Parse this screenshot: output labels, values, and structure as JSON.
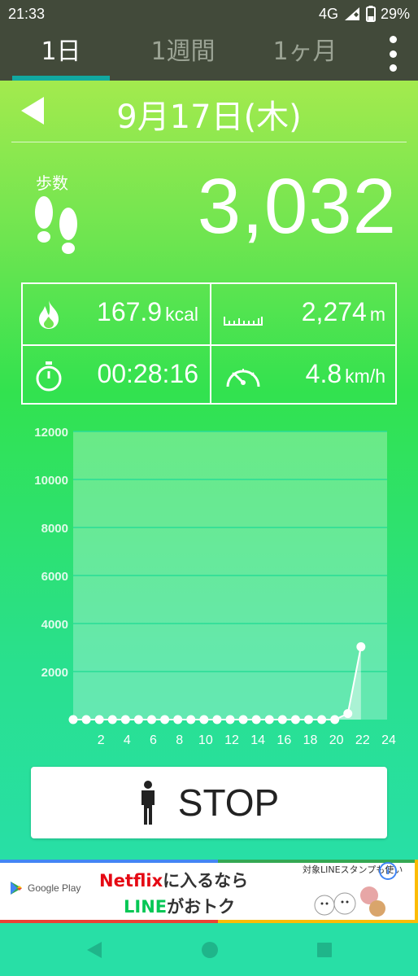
{
  "status_bar": {
    "time": "21:33",
    "network": "4G",
    "battery": "29%"
  },
  "tabs": [
    {
      "label": "1日",
      "active": true
    },
    {
      "label": "1週間",
      "active": false
    },
    {
      "label": "1ヶ月",
      "active": false
    }
  ],
  "date": "9月17日(木)",
  "steps": {
    "label": "歩数",
    "value": "3,032"
  },
  "stats": {
    "calories": {
      "value": "167.9",
      "unit": "kcal"
    },
    "distance": {
      "value": "2,274",
      "unit": "m"
    },
    "duration": {
      "value": "00:28:16"
    },
    "speed": {
      "value": "4.8",
      "unit": "km/h"
    }
  },
  "chart_data": {
    "type": "line",
    "x": [
      0,
      1,
      2,
      3,
      4,
      5,
      6,
      7,
      8,
      9,
      10,
      11,
      12,
      13,
      14,
      15,
      16,
      17,
      18,
      19,
      20,
      21,
      22
    ],
    "values": [
      0,
      0,
      0,
      0,
      0,
      0,
      0,
      0,
      0,
      0,
      0,
      0,
      0,
      0,
      0,
      0,
      0,
      0,
      0,
      0,
      0,
      250,
      3032
    ],
    "xlim": [
      0,
      24
    ],
    "ylim": [
      0,
      12000
    ],
    "y_ticks": [
      "12000",
      "10000",
      "8000",
      "6000",
      "4000",
      "2000"
    ],
    "x_ticks": [
      "2",
      "4",
      "6",
      "8",
      "10",
      "12",
      "14",
      "16",
      "18",
      "20",
      "22",
      "24"
    ],
    "grid": true
  },
  "stop_button": {
    "label": "STOP"
  },
  "ad": {
    "store": "Google Play",
    "line1_brand": "Netflix",
    "line1_rest": "に入るなら",
    "line2_brand": "LINE",
    "line2_rest": "がおトク",
    "small": "対象LINEスタンプも使い"
  },
  "colors": {
    "accent_tab": "#12a8a0",
    "status_bg": "#424a3a"
  }
}
